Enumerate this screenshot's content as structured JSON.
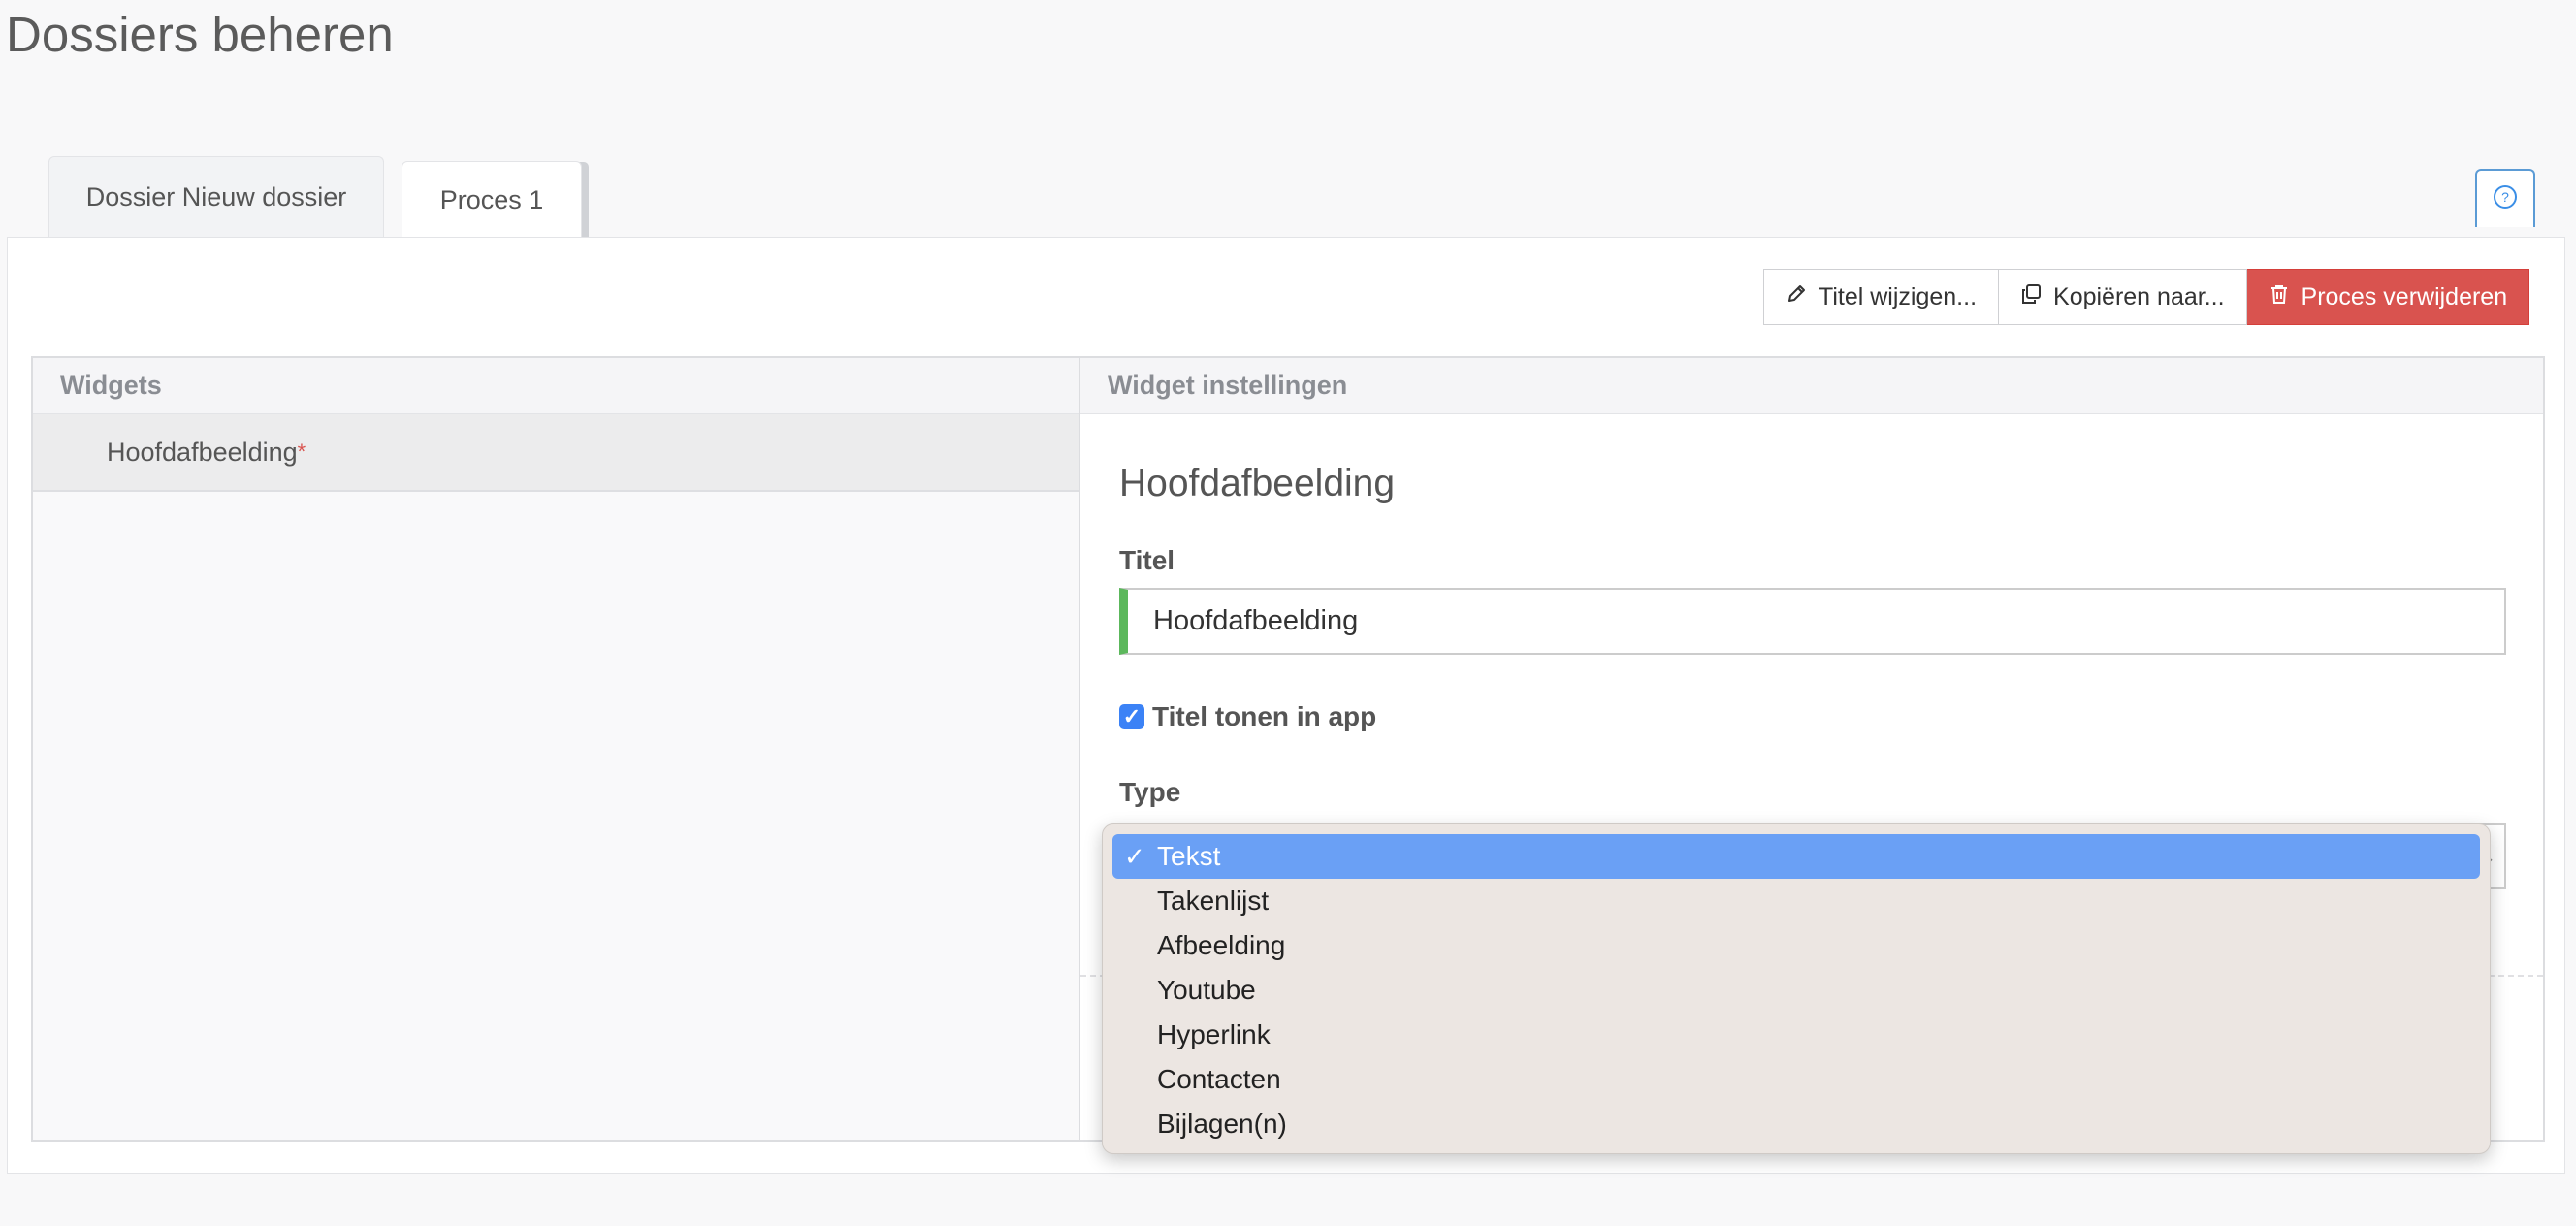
{
  "page": {
    "title": "Dossiers beheren"
  },
  "tabs": [
    {
      "label": "Dossier Nieuw dossier",
      "active": false
    },
    {
      "label": "Proces 1",
      "active": true
    }
  ],
  "help": {
    "icon": "question-circle-icon"
  },
  "toolbar": {
    "rename_label": "Titel wijzigen...",
    "copy_label": "Kopiëren naar...",
    "delete_label": "Proces verwijderen",
    "delete_color": "#d9534f"
  },
  "widgets_panel": {
    "header": "Widgets",
    "items": [
      {
        "label": "Hoofdafbeelding",
        "required_marker": "*"
      }
    ]
  },
  "settings_panel": {
    "header": "Widget instellingen",
    "widget_title": "Hoofdafbeelding",
    "title_label": "Titel",
    "title_value": "Hoofdafbeelding",
    "show_title_label": "Titel tonen in app",
    "show_title_checked": true,
    "type_label": "Type"
  },
  "type_dropdown": {
    "selected_check": "✓",
    "options": [
      "Tekst",
      "Takenlijst",
      "Afbeelding",
      "Youtube",
      "Hyperlink",
      "Contacten",
      "Bijlagen(n)"
    ],
    "selected_index": 0,
    "highlight_color": "#6aa0f5"
  }
}
